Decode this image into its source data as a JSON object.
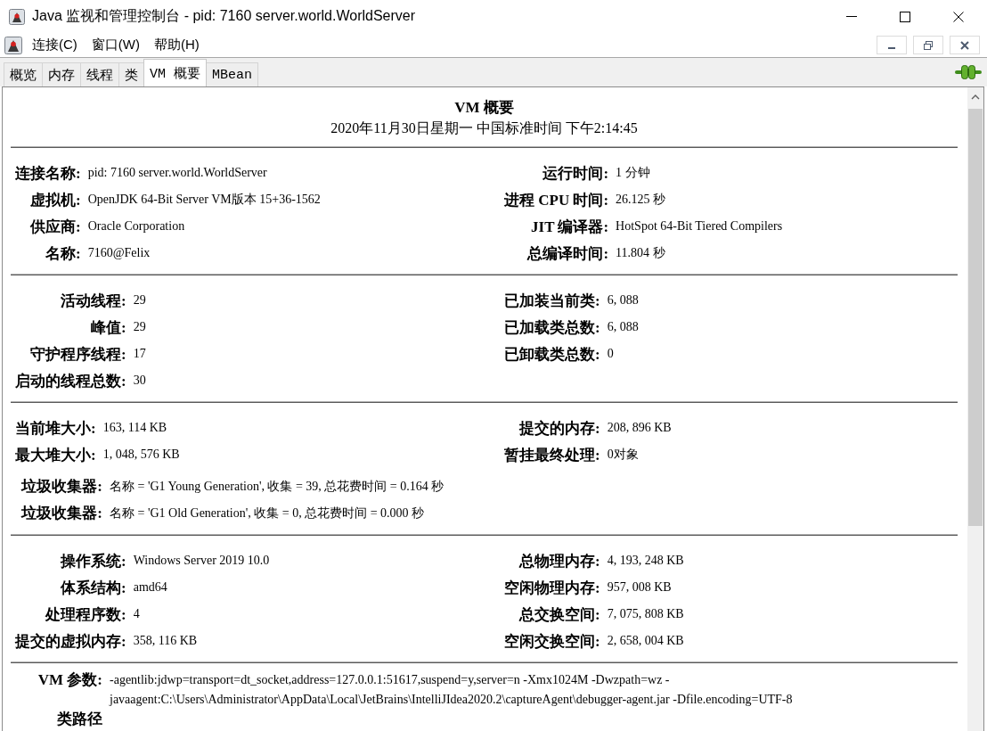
{
  "window": {
    "title": "Java 监视和管理控制台 - pid: 7160 server.world.WorldServer"
  },
  "menu_bar": {
    "items": [
      "连接(C)",
      "窗口(W)",
      "帮助(H)"
    ]
  },
  "tabs": [
    {
      "label": "概览",
      "selected": false
    },
    {
      "label": "内存",
      "selected": false
    },
    {
      "label": "线程",
      "selected": false
    },
    {
      "label": "类",
      "selected": false
    },
    {
      "label": "VM 概要",
      "selected": true
    },
    {
      "label": "MBean",
      "selected": false
    }
  ],
  "summary": {
    "title": "VM 概要",
    "timestamp": "2020年11月30日星期一 中国标准时间 下午2:14:45",
    "sections": [
      {
        "left": [
          {
            "label": "连接名称:",
            "value": "pid: 7160 server.world.WorldServer"
          },
          {
            "label": "虚拟机:",
            "value": "OpenJDK 64-Bit Server VM版本 15+36-1562"
          },
          {
            "label": "供应商:",
            "value": "Oracle Corporation"
          },
          {
            "label": "名称:",
            "value": "7160@Felix"
          }
        ],
        "right": [
          {
            "label": "运行时间:",
            "value": "1 分钟"
          },
          {
            "label": "进程 CPU 时间:",
            "value": "26.125 秒"
          },
          {
            "label": "JIT 编译器:",
            "value": "HotSpot 64-Bit Tiered Compilers"
          },
          {
            "label": "总编译时间:",
            "value": "11.804 秒"
          }
        ]
      },
      {
        "left": [
          {
            "label": "活动线程:",
            "value": "29"
          },
          {
            "label": "峰值:",
            "value": "29"
          },
          {
            "label": "守护程序线程:",
            "value": "17"
          },
          {
            "label": "启动的线程总数:",
            "value": "30"
          }
        ],
        "right": [
          {
            "label": "已加装当前类:",
            "value": "6, 088"
          },
          {
            "label": "已加载类总数:",
            "value": "6, 088"
          },
          {
            "label": "已卸载类总数:",
            "value": "0"
          }
        ]
      },
      {
        "left": [
          {
            "label": "当前堆大小:",
            "value": "163, 114 KB"
          },
          {
            "label": "最大堆大小:",
            "value": "1, 048, 576 KB"
          }
        ],
        "right": [
          {
            "label": "提交的内存:",
            "value": "208, 896 KB"
          },
          {
            "label": "暂挂最终处理:",
            "value": "0对象"
          }
        ],
        "wide": [
          {
            "label": "垃圾收集器:",
            "value": "名称 = 'G1 Young Generation', 收集 = 39, 总花费时间 = 0.164 秒"
          },
          {
            "label": "垃圾收集器:",
            "value": "名称 = 'G1 Old Generation', 收集 = 0, 总花费时间 = 0.000 秒"
          }
        ]
      },
      {
        "left": [
          {
            "label": "操作系统:",
            "value": "Windows Server 2019 10.0"
          },
          {
            "label": "体系结构:",
            "value": "amd64"
          },
          {
            "label": "处理程序数:",
            "value": "4"
          },
          {
            "label": "提交的虚拟内存:",
            "value": "358, 116 KB"
          }
        ],
        "right": [
          {
            "label": "总物理内存:",
            "value": "4, 193, 248 KB"
          },
          {
            "label": "空闲物理内存:",
            "value": "957, 008 KB"
          },
          {
            "label": "总交换空间:",
            "value": "7, 075, 808 KB"
          },
          {
            "label": "空闲交换空间:",
            "value": "2, 658, 004 KB"
          }
        ]
      },
      {
        "wide": [
          {
            "label": "VM 参数:",
            "value": "-agentlib:jdwp=transport=dt_socket,address=127.0.0.1:51617,suspend=y,server=n -Xmx1024M -Dwzpath=wz -javaagent:C:\\Users\\Administrator\\AppData\\Local\\JetBrains\\IntelliJIdea2020.2\\captureAgent\\debugger-agent.jar -Dfile.encoding=UTF-8"
          },
          {
            "label": "类路径"
          }
        ]
      }
    ]
  }
}
